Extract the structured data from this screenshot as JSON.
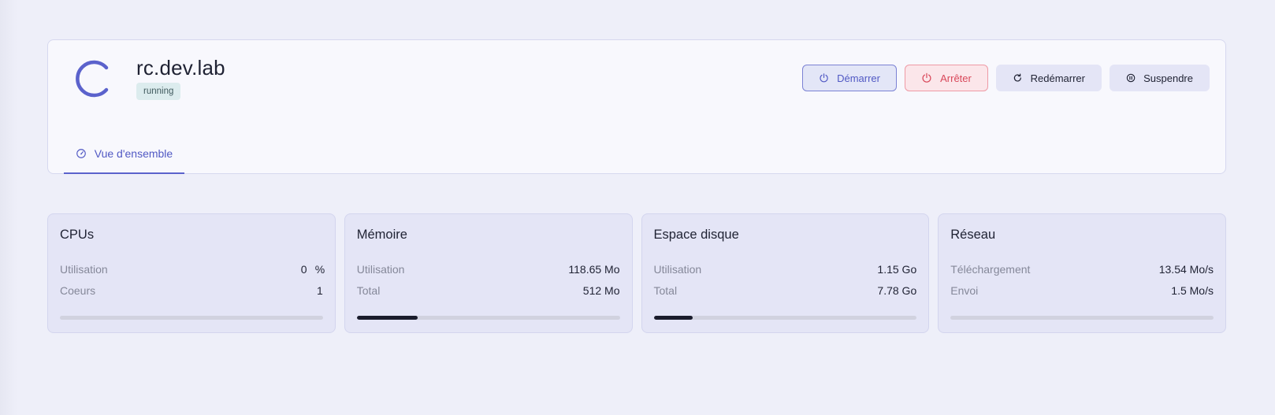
{
  "header": {
    "host_name": "rc.dev.lab",
    "status": "running",
    "accent_color": "#5b62cc",
    "actions": {
      "start": "Démarrer",
      "stop": "Arrêter",
      "restart": "Redémarrer",
      "suspend": "Suspendre"
    },
    "tabs": [
      {
        "label": "Vue d'ensemble",
        "icon": "gauge-icon",
        "active": true
      }
    ]
  },
  "metrics": {
    "cpu": {
      "title": "CPUs",
      "usage_label": "Utilisation",
      "usage_value": "0",
      "usage_unit": "%",
      "cores_label": "Coeurs",
      "cores_value": "1",
      "fill_fraction": 0
    },
    "memory": {
      "title": "Mémoire",
      "usage_label": "Utilisation",
      "usage_value": "118.65 Mo",
      "total_label": "Total",
      "total_value": "512 Mo",
      "fill_fraction": 0.2317
    },
    "disk": {
      "title": "Espace disque",
      "usage_label": "Utilisation",
      "usage_value": "1.15 Go",
      "total_label": "Total",
      "total_value": "7.78 Go",
      "fill_fraction": 0.1478
    },
    "network": {
      "title": "Réseau",
      "download_label": "Téléchargement",
      "download_value": "13.54 Mo/s",
      "upload_label": "Envoi",
      "upload_value": "1.5 Mo/s",
      "fill_fraction": 0
    }
  }
}
